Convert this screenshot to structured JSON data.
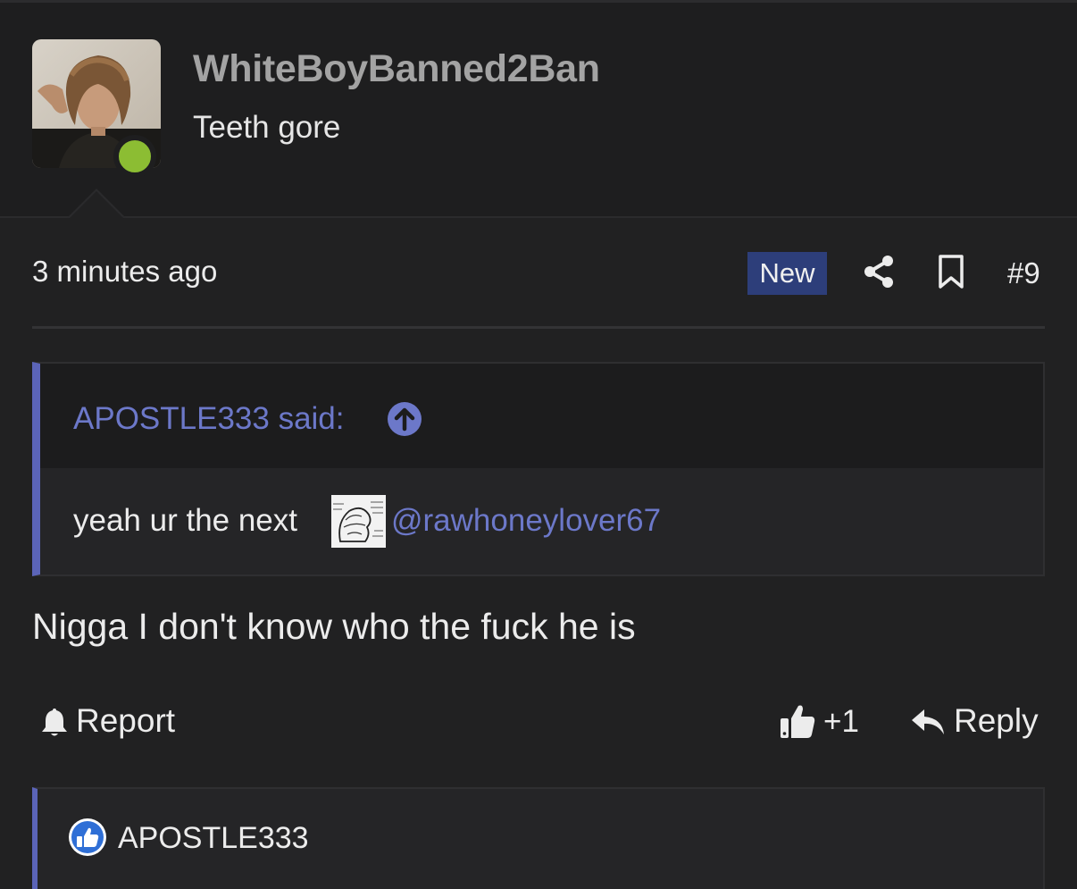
{
  "user": {
    "username": "WhiteBoyBanned2Ban",
    "title": "Teeth gore",
    "online_color": "#8cbd33"
  },
  "post": {
    "timestamp": "3 minutes ago",
    "badge": "New",
    "number": "#9",
    "body": "Nigga I don't know who the fuck he is"
  },
  "quote": {
    "author_said": "APOSTLE333 said:",
    "text": "yeah ur the next",
    "mention": "@rawhoneylover67"
  },
  "actions": {
    "report": "Report",
    "like_count": "+1",
    "reply": "Reply"
  },
  "reactions": {
    "user": "APOSTLE333"
  },
  "colors": {
    "accent": "#5b64b8",
    "link": "#6c78c9",
    "badge_bg": "#2d3e7a",
    "background": "#212122"
  }
}
